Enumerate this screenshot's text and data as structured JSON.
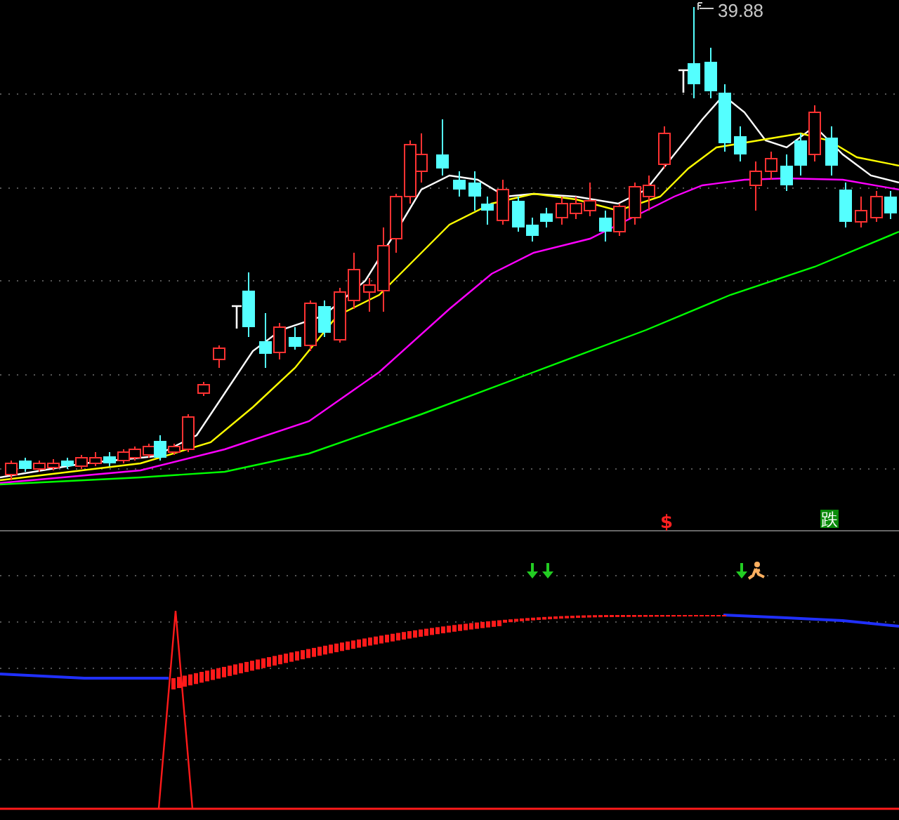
{
  "chart": {
    "high_label": "39.88",
    "dollar_marker": "$",
    "fall_badge": "跌"
  }
}
